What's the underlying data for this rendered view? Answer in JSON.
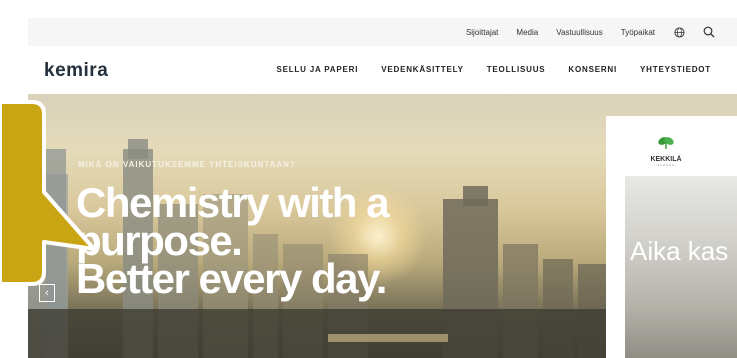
{
  "utility_nav": {
    "items": [
      "Sijoittajat",
      "Media",
      "Vastuullisuus",
      "Työpaikat"
    ],
    "icons": [
      "globe-icon",
      "search-icon"
    ]
  },
  "header": {
    "logo": "kemira",
    "nav": [
      "SELLU JA PAPERI",
      "VEDENKÄSITTELY",
      "TEOLLISUUS",
      "KONSERNI",
      "YHTEYSTIEDOT"
    ]
  },
  "hero": {
    "eyebrow": "MIKÄ ON VAIKUTUKSEMME YHTEISKUNTAAN?",
    "headline_1": "Chemistry with a",
    "headline_2": "purpose.",
    "headline_3": "Better every day.",
    "prev_arrow": "‹"
  },
  "side_card": {
    "brand": "KEKKILÄ",
    "sub": "GARDEN",
    "text": "Aika kas"
  },
  "colors": {
    "callout": "#c9a514",
    "logo": "#24303c",
    "card_leaf": "#3a9a3a"
  }
}
